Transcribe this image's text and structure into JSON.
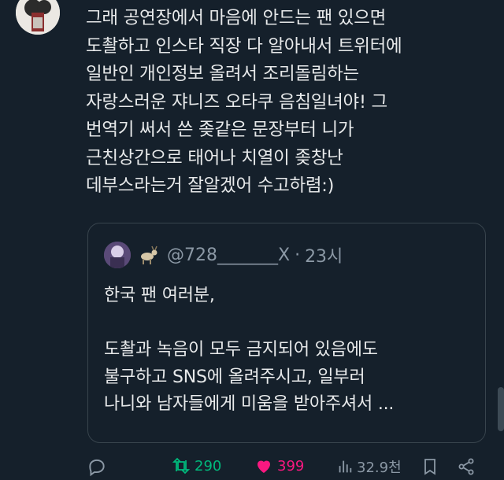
{
  "tweet": {
    "text": "그래 공연장에서 마음에 안드는 팬 있으면\n도촬하고 인스타 직장 다 알아내서 트위터에\n일반인 개인정보 올려서 조리돌림하는\n자랑스러운 쟈니즈 오타쿠 음침일녀야! 그\n번역기 써서 쓴 좆같은 문장부터 니가\n근친상간으로 태어나 치열이 좆창난\n데부스라는거 잘알겠어 수고하렴:)"
  },
  "quoted": {
    "handle": "@728_______X",
    "separator": "·",
    "time": "23시",
    "text": "한국 팬 여러분,\n\n 도촬과 녹음이 모두 금지되어 있음에도\n불구하고 SNS에 올려주시고, 일부러\n나니와 남자들에게 미움을 받아주셔서 ..."
  },
  "actions": {
    "reply_icon": "reply-icon",
    "retweets": "290",
    "likes": "399",
    "views": "32.9천",
    "colors": {
      "retweet": "#00ba7c",
      "like": "#f91880",
      "muted": "#8b98a5"
    }
  }
}
